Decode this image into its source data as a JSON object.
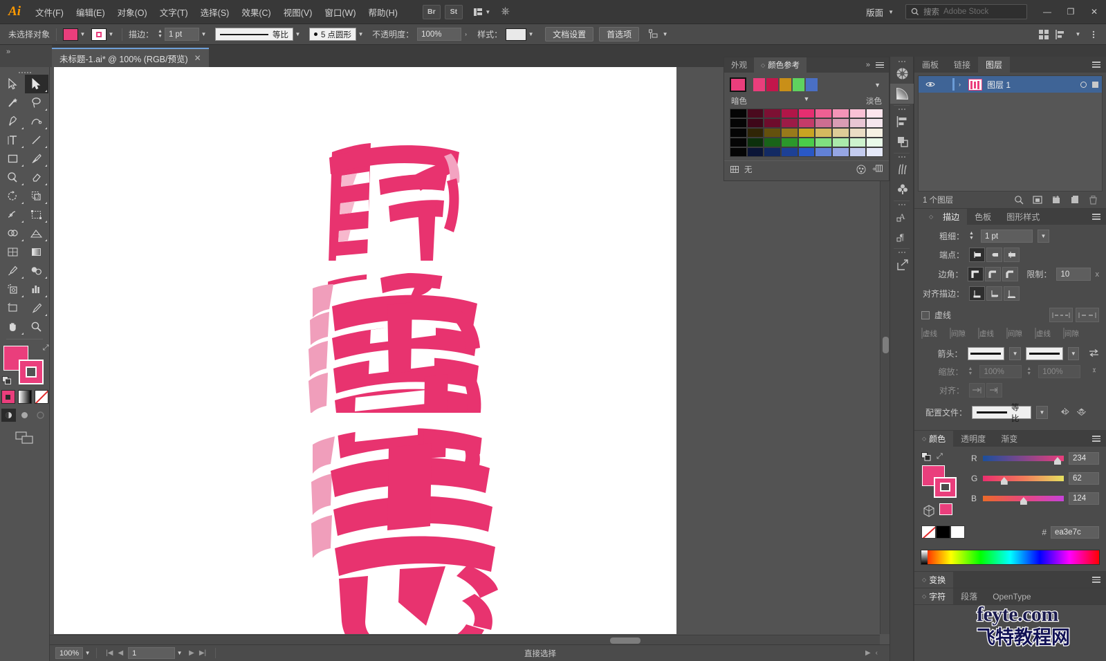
{
  "app": {
    "logo": "Ai",
    "menus": [
      "文件(F)",
      "编辑(E)",
      "对象(O)",
      "文字(T)",
      "选择(S)",
      "效果(C)",
      "视图(V)",
      "窗口(W)",
      "帮助(H)"
    ],
    "bridge_label": "Br",
    "stock_label": "St",
    "layout_label": "版面",
    "search_label": "搜索",
    "search_placeholder": "Adobe Stock",
    "win_minimize": "—",
    "win_maximize": "❐",
    "win_close": "✕"
  },
  "control_bar": {
    "selection_status": "未选择对象",
    "fill_color": "#ea3e7c",
    "stroke_color": "#ea3e7c",
    "stroke_label": "描边：",
    "stroke_weight": "1 pt",
    "stroke_profile": "等比",
    "brush_label": "5 点圆形",
    "opacity_label": "不透明度：",
    "opacity_value": "100%",
    "style_label": "样式：",
    "doc_setup": "文档设置",
    "preferences": "首选项"
  },
  "tabs": {
    "document": "未标题-1.ai* @ 100% (RGB/预览)",
    "close_glyph": "✕"
  },
  "color_guide": {
    "tab_appearance": "外观",
    "tab_color_guide": "颜色参考",
    "expand_glyph": "»",
    "base_color": "#ea3e7c",
    "harmony_swatches": [
      "#ea3e7c",
      "#c3164b",
      "#c98f18",
      "#5fd25f",
      "#4a6fc4"
    ],
    "shade_label": "暗色",
    "tint_label": "淡色",
    "footer_none": "无",
    "grid_rows": [
      [
        "#000000",
        "#48091c",
        "#7c0f31",
        "#b01546",
        "#e52d6f",
        "#ee5f91",
        "#f393b6",
        "#f8c0d4",
        "#fce4ec"
      ],
      [
        "#000000",
        "#3d0618",
        "#6d0b2b",
        "#9c1a46",
        "#c33a68",
        "#cc6d90",
        "#d99bb3",
        "#e7c5d3",
        "#f4e6ed"
      ],
      [
        "#000000",
        "#2f2406",
        "#63500c",
        "#97791a",
        "#c7a321",
        "#d4b85e",
        "#ddcb96",
        "#e9dcc3",
        "#f5f0e3"
      ],
      [
        "#000000",
        "#0b2f0b",
        "#186318",
        "#2a972a",
        "#49cb49",
        "#7fde7f",
        "#a9e9a9",
        "#ccf2cc",
        "#e8f9e8"
      ],
      [
        "#000000",
        "#0a1436",
        "[",
        " ",
        "",
        "",
        "",
        "",
        ""
      ]
    ],
    "grid_rows_fixed": [
      [
        "#050505",
        "#4a0a1e",
        "#7d1033",
        "#b11648",
        "#e62e70",
        "#ef6093",
        "#f494b7",
        "#f9c1d5",
        "#fde5ed"
      ],
      [
        "#050505",
        "#3e0719",
        "#6e0c2c",
        "#9d1b47",
        "#c43b69",
        "#cd6e91",
        "#da9cb4",
        "#e8c6d4",
        "#f5e7ee"
      ],
      [
        "#050505",
        "#302506",
        "#64510d",
        "#987a1b",
        "#c8a422",
        "#d5b95f",
        "#decc97",
        "#eaddc4",
        "#f6f1e4"
      ],
      [
        "#050505",
        "#0c300c",
        "#196419",
        "#2b982b",
        "#4acc4a",
        "#80df80",
        "#aaeaaa",
        "#cdf3cd",
        "#e9fae9"
      ],
      [
        "#050505",
        "#0b1537",
        "#132a63",
        "#1d4095",
        "#2a58c6",
        "#6281d6",
        "#96a6e3",
        "#c3cbee",
        "#e5e9f8"
      ]
    ]
  },
  "layers_panel": {
    "tabs": [
      "画板",
      "链接",
      "图层"
    ],
    "active_tab": "图层",
    "layer_name": "图层 1",
    "count_label": "1 个图层",
    "expand_glyph": "›"
  },
  "stroke_panel": {
    "tabs": [
      "描边",
      "色板",
      "图形样式"
    ],
    "active_tab": "描边",
    "weight_label": "粗细：",
    "weight_value": "1 pt",
    "cap_label": "端点：",
    "corner_label": "边角：",
    "limit_label": "限制：",
    "limit_value": "10",
    "limit_unit": "x",
    "align_label": "对齐描边：",
    "dashed_label": "虚线",
    "dash_labels": [
      "虚线",
      "间隙",
      "虚线",
      "间隙",
      "虚线",
      "间隙"
    ],
    "arrow_label": "箭头：",
    "scale_label": "缩放：",
    "scale_value_1": "100%",
    "scale_value_2": "100%",
    "align_arrow_label": "对齐：",
    "profile_label": "配置文件：",
    "profile_value": "等比"
  },
  "color_panel": {
    "tabs": [
      "颜色",
      "透明度",
      "渐变"
    ],
    "active_tab": "颜色",
    "channels": [
      {
        "name": "R",
        "value": "234",
        "pos": 91
      },
      {
        "name": "G",
        "value": "62",
        "pos": 24
      },
      {
        "name": "B",
        "value": "124",
        "pos": 48
      }
    ],
    "hex_prefix": "#",
    "hex_value": "ea3e7c",
    "current_color": "#ea3e7c"
  },
  "bottom_panels": {
    "transform_tab": "变换",
    "character_tab": "字符",
    "paragraph_tab": "段落",
    "opentype_tab": "OpenType"
  },
  "status_bar": {
    "zoom": "100%",
    "page": "1",
    "tool_status": "直接选择"
  },
  "watermark": {
    "line1": "feyte.com",
    "line2": "飞特教程网"
  },
  "artwork": {
    "description": "野鬼志 stylized pink calligraphy on curved ribbons",
    "color_main": "#e8336f",
    "color_light": "#f4a0bd",
    "characters": [
      "野",
      "鬼",
      "志"
    ]
  },
  "toolbar": {
    "tools": [
      "selection-tool",
      "direct-selection-tool",
      "magic-wand-tool",
      "lasso-tool",
      "pen-tool",
      "curvature-tool",
      "type-tool",
      "line-segment-tool",
      "rectangle-tool",
      "paintbrush-tool",
      "shaper-tool",
      "eraser-tool",
      "rotate-tool",
      "scale-tool",
      "width-tool",
      "free-transform-tool",
      "shape-builder-tool",
      "perspective-grid-tool",
      "mesh-tool",
      "gradient-tool",
      "eyedropper-tool",
      "blend-tool",
      "symbol-sprayer-tool",
      "column-graph-tool",
      "artboard-tool",
      "slice-tool",
      "hand-tool",
      "zoom-tool"
    ]
  }
}
